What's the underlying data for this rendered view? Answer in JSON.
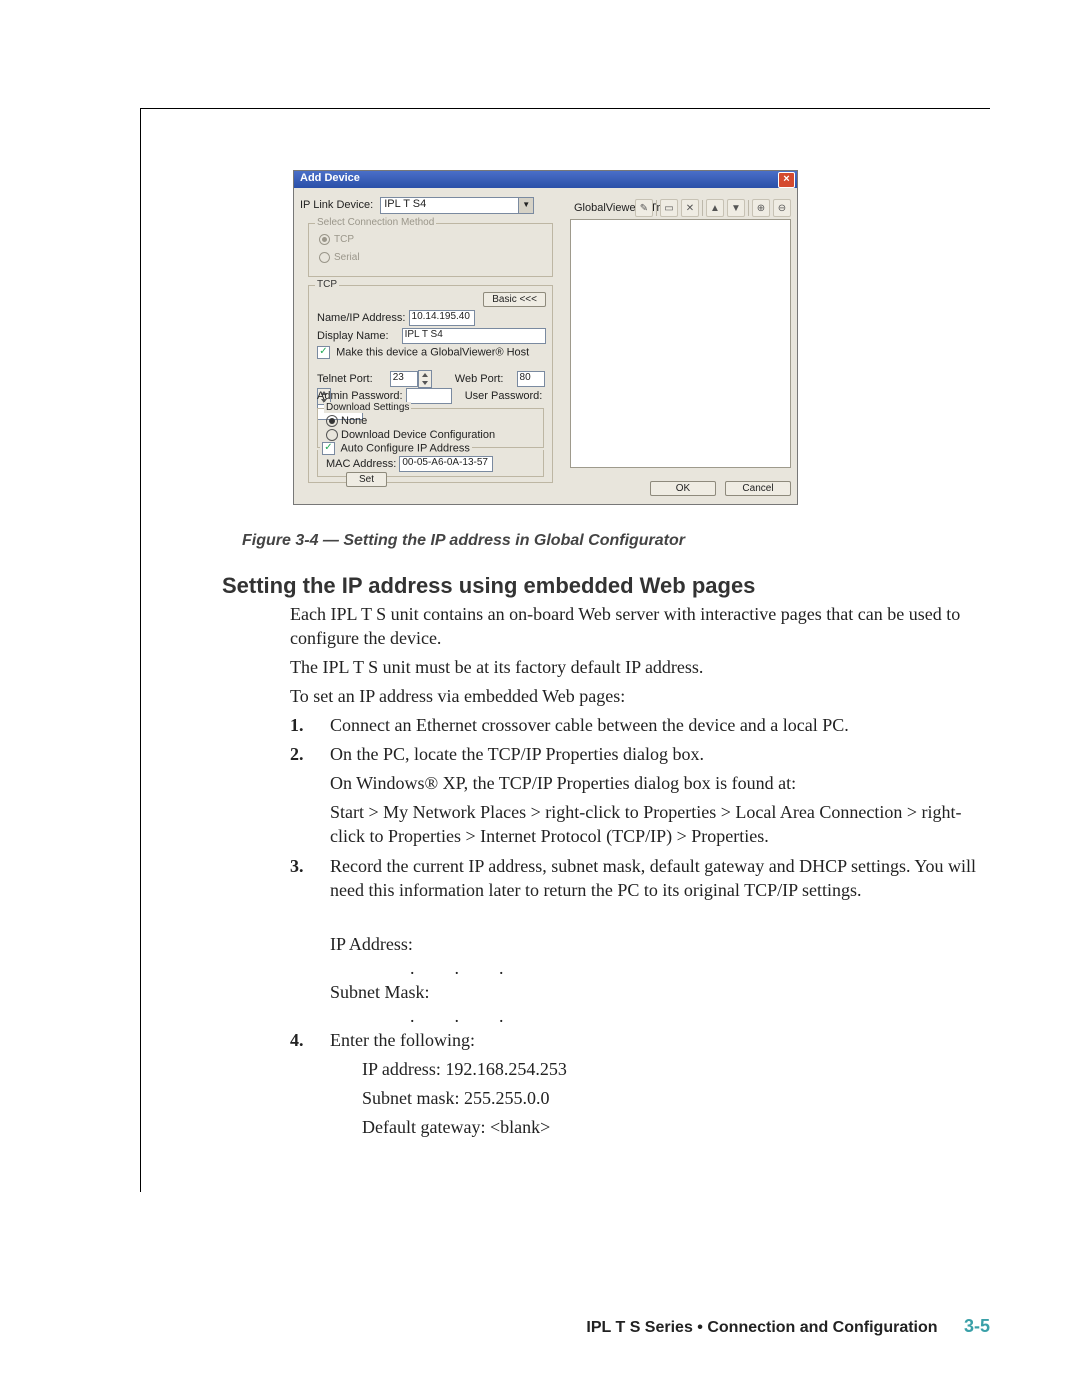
{
  "dialog": {
    "title": "Add Device",
    "ip_link_label": "IP Link Device:",
    "ip_link_value": "IPL T S4",
    "tree_label": "GlobalViewer® Tree",
    "conn_method": {
      "legend": "Select Connection Method",
      "tcp": "TCP",
      "serial": "Serial"
    },
    "tcp": {
      "legend": "TCP",
      "basic_btn": "Basic <<<",
      "name_ip_label": "Name/IP Address:",
      "name_ip_value": "10.14.195.40",
      "disp_label": "Display Name:",
      "disp_value": "IPL T S4",
      "gv_host": "Make this device a GlobalViewer® Host",
      "telnet_label": "Telnet Port:",
      "telnet_value": "23",
      "web_label": "Web Port:",
      "web_value": "80",
      "admin_pw": "Admin Password:",
      "user_pw": "User Password:",
      "dl": {
        "legend": "Download Settings",
        "none": "None",
        "ddc": "Download Device Configuration"
      },
      "auto": "Auto Configure IP Address",
      "mac_label": "MAC Address:",
      "mac_value": "00-05-A6-0A-13-57",
      "set": "Set"
    },
    "ok": "OK",
    "cancel": "Cancel"
  },
  "doc": {
    "caption": "Figure 3-4 — Setting the IP address in Global Configurator",
    "heading": "Setting the IP address using embedded Web pages",
    "p1": "Each IPL T S unit contains an on-board Web server with interactive pages that can be used to configure the device.",
    "p2": "The IPL T S unit must be at its factory default IP address.",
    "p3": "To set an IP address via embedded Web pages:",
    "s1n": "1.",
    "s1": "Connect an Ethernet crossover cable between the device and a local PC.",
    "s2n": "2.",
    "s2": "On the PC, locate the TCP/IP Properties dialog box.",
    "s2b": "On Windows® XP, the TCP/IP Properties dialog box is found at:",
    "s2c": "Start > My Network Places > right-click to Properties > Local Area Connection > right-click to Properties > Internet Protocol (TCP/IP) > Properties.",
    "s3n": "3.",
    "s3": "Record the current IP address, subnet mask, default gateway and DHCP settings.  You will need this information later to return the PC to its original TCP/IP settings.",
    "s3ip": " IP Address:",
    "s3sm": "Subnet Mask:",
    "s4n": "4.",
    "s4": "Enter the following:",
    "s4a": "IP address: 192.168.254.253",
    "s4b": "Subnet mask: 255.255.0.0",
    "s4c": "Default gateway: <blank>",
    "footer": "IPL T S Series • Connection and Configuration",
    "page": "3-5"
  }
}
